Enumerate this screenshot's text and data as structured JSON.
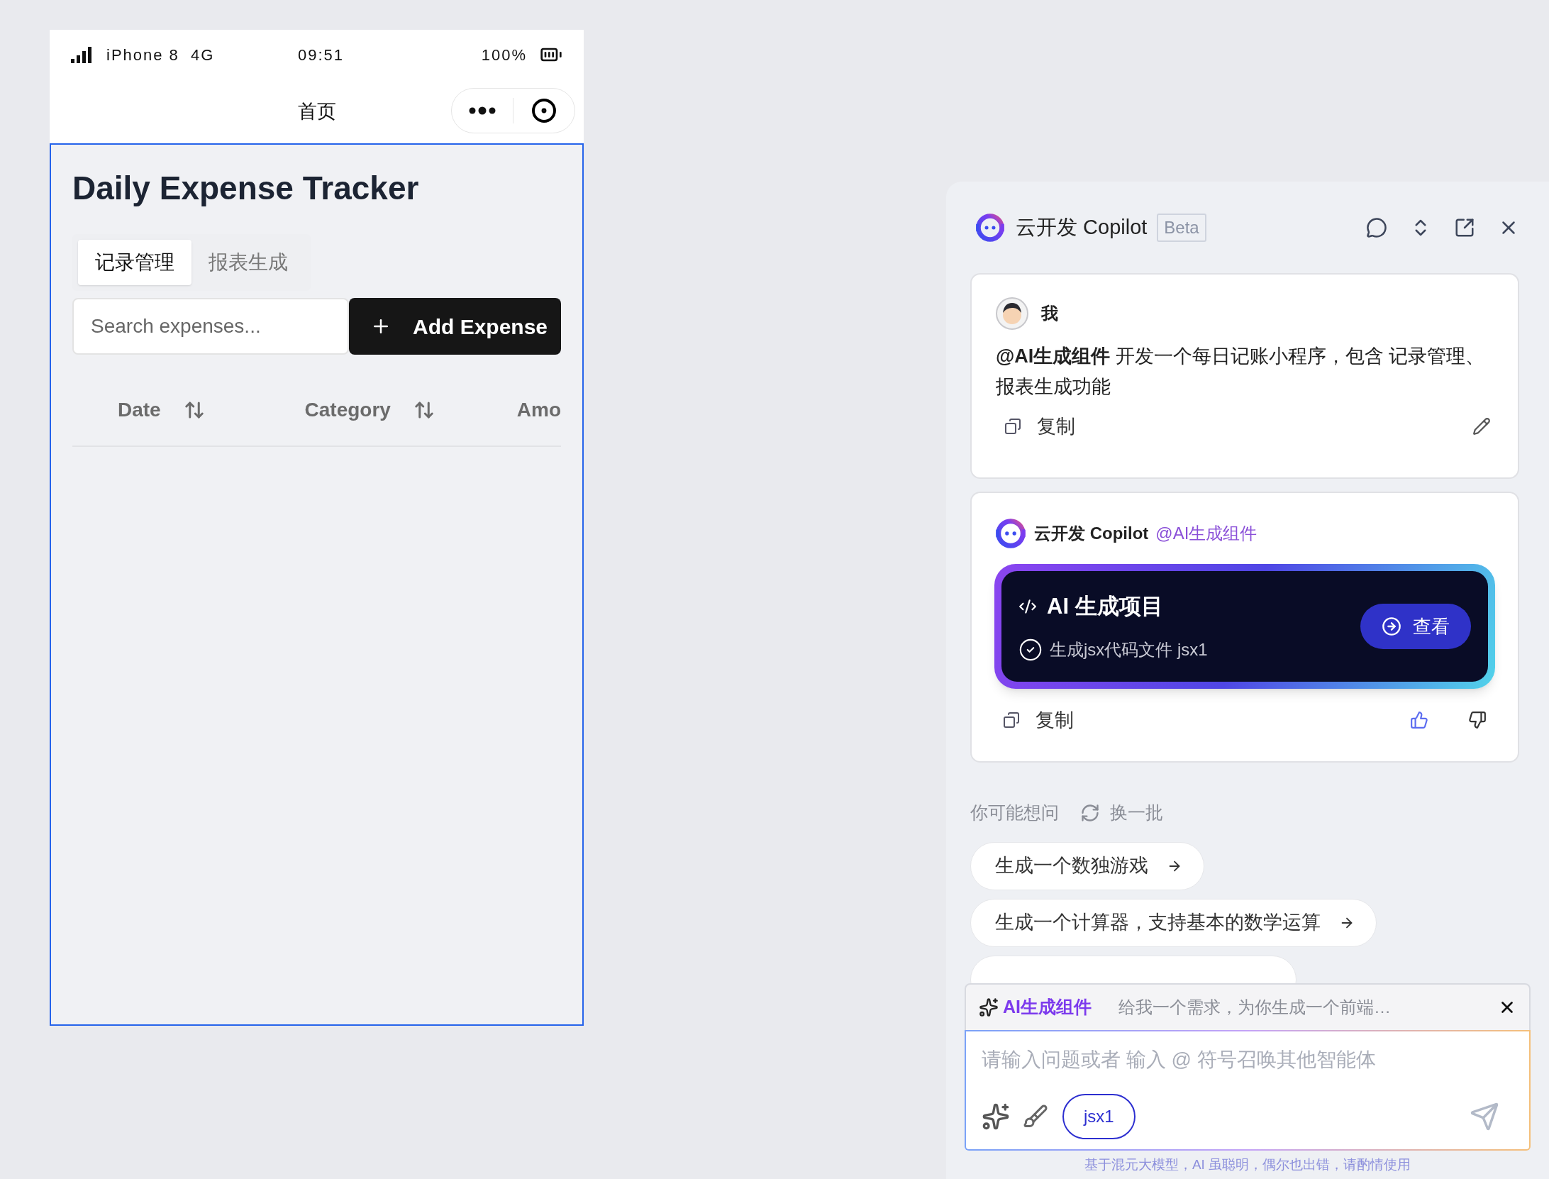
{
  "phone": {
    "status_bar": {
      "carrier": "iPhone 8  4G",
      "time": "09:51",
      "battery": "100%"
    },
    "nav_title": "首页",
    "title": "Daily Expense Tracker",
    "tabs": [
      {
        "label": "记录管理",
        "selected": true
      },
      {
        "label": "报表生成",
        "selected": false
      }
    ],
    "search": {
      "placeholder": "Search expenses..."
    },
    "add_button": "Add Expense",
    "columns": [
      {
        "label": "Date",
        "sortable": true
      },
      {
        "label": "Category",
        "sortable": true
      },
      {
        "label": "Amo",
        "sortable": false
      }
    ]
  },
  "copilot": {
    "title": "云开发 Copilot",
    "badge": "Beta",
    "messages": [
      {
        "kind": "user",
        "author": "我",
        "text": "**@AI生成组件** 开发一个每日记账小程序，包含 记录管理、报表生成功能",
        "copy": "复制"
      },
      {
        "kind": "bot",
        "author": "云开发 Copilot",
        "mention": "@AI生成组件",
        "project": {
          "title": "AI 生成项目",
          "step": "生成jsx代码文件 jsx1",
          "done": true,
          "button": "查看"
        },
        "copy": "复制"
      }
    ],
    "suggestions": {
      "label": "你可能想问",
      "refresh": "换一批",
      "items": [
        "生成一个数独游戏",
        "生成一个计算器，支持基本的数学运算"
      ]
    },
    "agent": {
      "name": "AI生成组件",
      "description": "给我一个需求，为你生成一个前端…"
    },
    "input": {
      "placeholder": "请输入问题或者 输入 @ 符号召唤其他智能体",
      "chip": "jsx1"
    },
    "footer": "基于混元大模型，AI 虽聪明，偶尔也出错，请酌情使用"
  }
}
